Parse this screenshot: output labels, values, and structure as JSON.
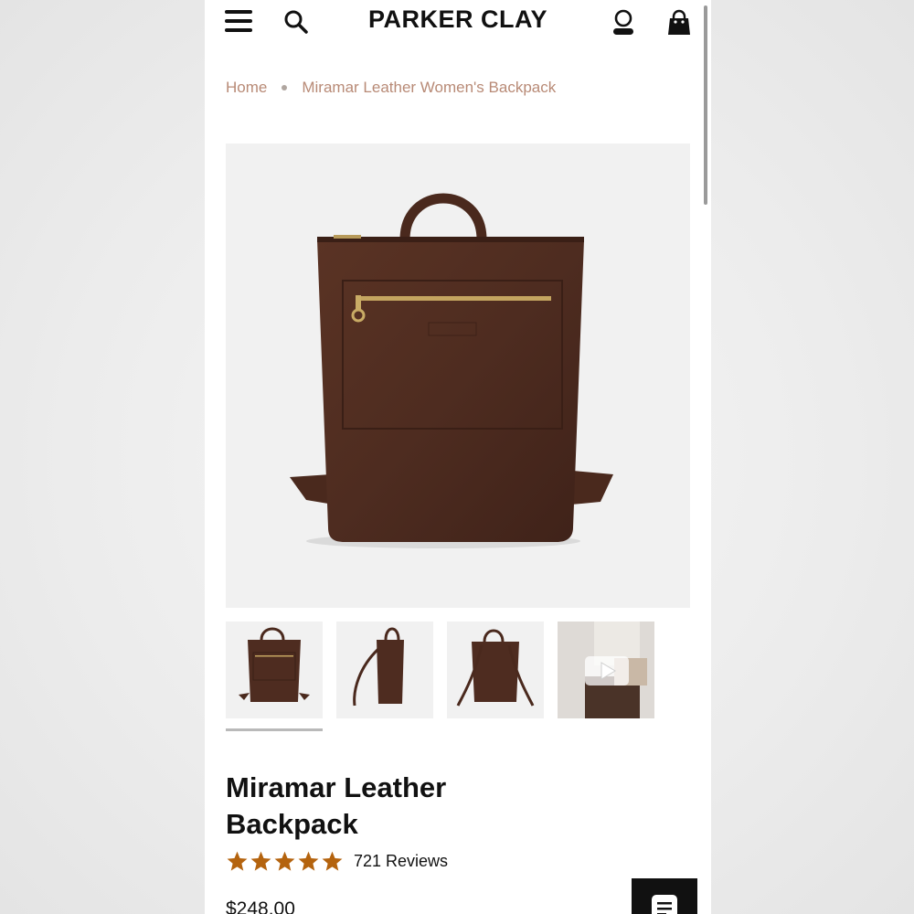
{
  "brand": "PARKER CLAY",
  "header": {
    "menu_icon": "hamburger-menu-icon",
    "search_icon": "search-icon",
    "account_icon": "account-icon",
    "cart_icon": "shopping-bag-icon"
  },
  "breadcrumb": {
    "home": "Home",
    "current": "Miramar Leather Women's Backpack"
  },
  "gallery": {
    "thumbnails": [
      {
        "view": "front",
        "selected": true
      },
      {
        "view": "side",
        "selected": false
      },
      {
        "view": "back",
        "selected": false
      },
      {
        "view": "video",
        "selected": false,
        "icon": "play-icon"
      }
    ]
  },
  "product": {
    "title": "Miramar Leather Backpack",
    "rating": 5,
    "reviews": "721 Reviews",
    "price": "$248.00"
  },
  "colors": {
    "breadcrumb": "#b88a76",
    "star": "#b4630e",
    "leather": "#4e2c20",
    "image_bg": "#f1f1f1"
  }
}
